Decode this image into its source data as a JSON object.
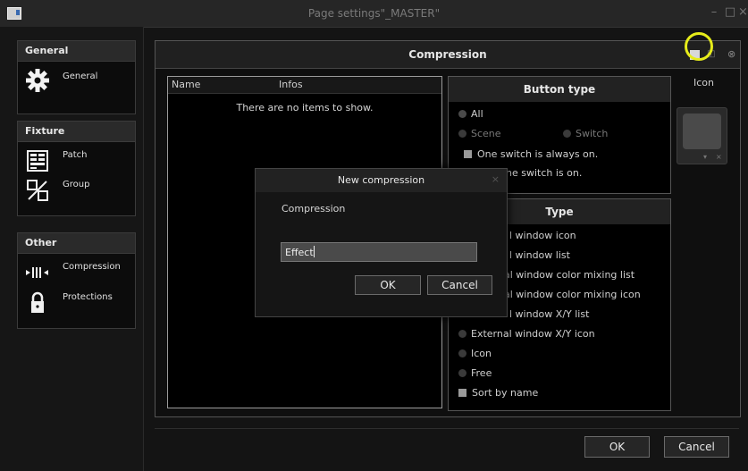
{
  "window": {
    "title": "Page settings\"_MASTER\"",
    "min_label": "–",
    "max_label": "□",
    "close_label": "×"
  },
  "sidebar": {
    "general": {
      "heading": "General",
      "items": [
        {
          "label": "General",
          "icon": "gear-icon"
        }
      ]
    },
    "fixture": {
      "heading": "Fixture",
      "items": [
        {
          "label": "Patch",
          "icon": "patch-icon"
        },
        {
          "label": "Group",
          "icon": "group-icon"
        }
      ]
    },
    "other": {
      "heading": "Other",
      "items": [
        {
          "label": "Compression",
          "icon": "compression-icon"
        },
        {
          "label": "Protections",
          "icon": "lock-icon"
        }
      ]
    }
  },
  "main": {
    "title": "Compression",
    "list": {
      "columns": [
        "Name",
        "Infos"
      ],
      "empty_text": "There are no items to show."
    },
    "button_type": {
      "heading": "Button type",
      "options": [
        "All",
        "Scene",
        "Switch"
      ],
      "checkboxes": [
        "One switch is always on.",
        "ne switch is on."
      ]
    },
    "type": {
      "heading": "Type",
      "options": [
        "l window icon",
        "l window list",
        "al window color mixing list",
        "al window color mixing icon",
        "l window X/Y list",
        "External window X/Y icon",
        "Icon",
        "Free"
      ],
      "sort_label": "Sort by name"
    },
    "icon": {
      "label": "Icon",
      "tile_down": "▾",
      "tile_clear": "×"
    }
  },
  "dialog": {
    "title": "New compression",
    "close": "×",
    "field_label": "Compression",
    "field_value": "Effect",
    "ok_label": "OK",
    "cancel_label": "Cancel"
  },
  "footer": {
    "ok_label": "OK",
    "cancel_label": "Cancel"
  },
  "colors": {
    "highlight": "#e6ec1a",
    "background": "#141414"
  }
}
